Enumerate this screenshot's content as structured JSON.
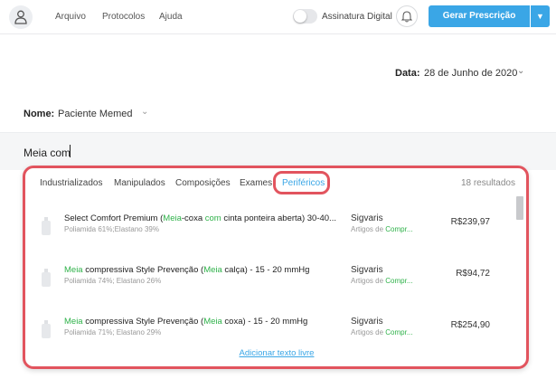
{
  "header": {
    "nav": [
      "Arquivo",
      "Protocolos",
      "Ajuda"
    ],
    "toggle_label": "Assinatura Digital",
    "toggle_on": false,
    "primary_button": "Gerar Prescrição",
    "accent_color": "#3aa6e6"
  },
  "form": {
    "date_label": "Data:",
    "date_value": "28 de Junho de 2020",
    "patient_label": "Nome:",
    "patient_value": "Paciente Memed",
    "search_value": "Meia com"
  },
  "results": {
    "tabs": [
      "Industrializados",
      "Manipulados",
      "Composições",
      "Exames",
      "Periféricos"
    ],
    "active_tab": "Periféricos",
    "count": "18 resultados",
    "items": [
      {
        "name_parts": [
          {
            "t": "Select Comfort Premium (",
            "h": false
          },
          {
            "t": "Meia",
            "h": true
          },
          {
            "t": "-coxa ",
            "h": false
          },
          {
            "t": "com",
            "h": true
          },
          {
            "t": " cinta ponteira aberta) 30-40...",
            "h": false
          }
        ],
        "composition": "Poliamida 61%;Elastano 39%",
        "brand": "Sigvaris",
        "category_parts": [
          {
            "t": "Artigos de ",
            "h": false
          },
          {
            "t": "Compr...",
            "h": true
          }
        ],
        "price": "R$239,97"
      },
      {
        "name_parts": [
          {
            "t": "Meia",
            "h": true
          },
          {
            "t": " compressiva Style Prevenção (",
            "h": false
          },
          {
            "t": "Meia",
            "h": true
          },
          {
            "t": " calça) - 15 - 20 mmHg",
            "h": false
          }
        ],
        "composition": "Poliamida 74%; Elastano 26%",
        "brand": "Sigvaris",
        "category_parts": [
          {
            "t": "Artigos de ",
            "h": false
          },
          {
            "t": "Compr...",
            "h": true
          }
        ],
        "price": "R$94,72"
      },
      {
        "name_parts": [
          {
            "t": "Meia",
            "h": true
          },
          {
            "t": " compressiva Style Prevenção (",
            "h": false
          },
          {
            "t": "Meia",
            "h": true
          },
          {
            "t": " coxa) - 15 - 20 mmHg",
            "h": false
          }
        ],
        "composition": "Poliamida 71%; Elastano 29%",
        "brand": "Sigvaris",
        "category_parts": [
          {
            "t": "Artigos de ",
            "h": false
          },
          {
            "t": "Compr...",
            "h": true
          }
        ],
        "price": "R$254,90"
      }
    ],
    "footer_link": "Adicionar texto livre",
    "highlight_color": "#2fb24a",
    "annotation_color": "#e2545e"
  }
}
